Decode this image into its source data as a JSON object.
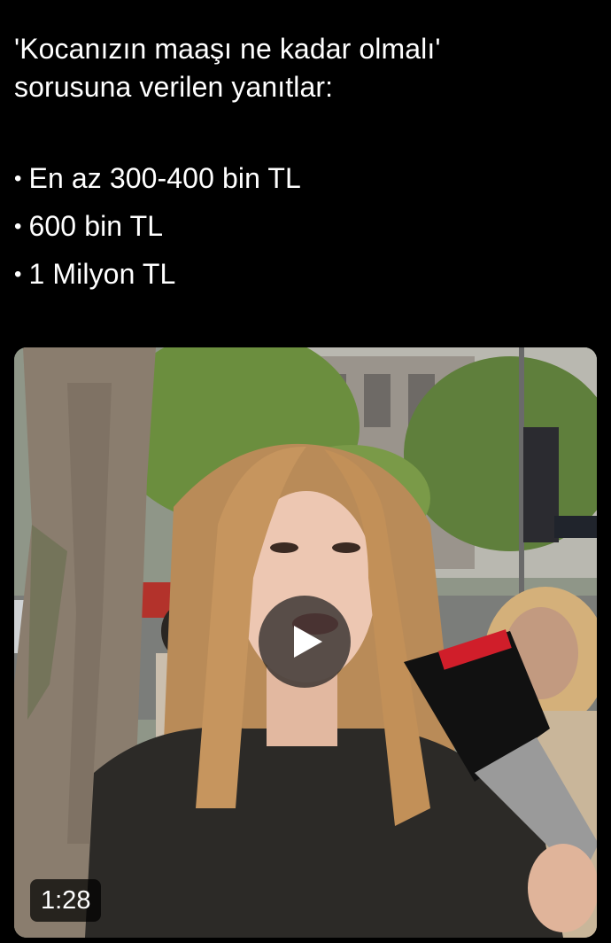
{
  "post": {
    "line1": "'Kocanızın maaşı ne kadar olmalı'",
    "line2": "sorusuna verilen yanıtlar:",
    "bullets": [
      "En az 300-400 bin TL",
      "600 bin TL",
      "1 Milyon TL"
    ],
    "bullet_char": "•"
  },
  "video": {
    "duration": "1:28",
    "play_icon": "play-icon"
  }
}
